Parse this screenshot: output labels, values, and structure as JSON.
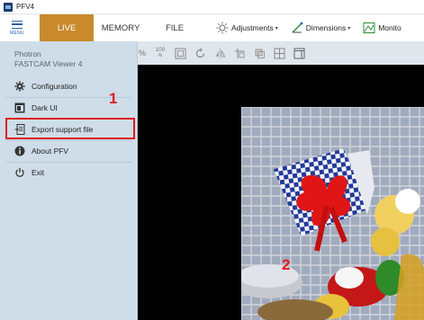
{
  "window": {
    "title": "PFV4"
  },
  "ribbon": {
    "menu_label": "MENU",
    "tabs": [
      {
        "label": "LIVE",
        "active": true
      },
      {
        "label": "MEMORY",
        "active": false
      },
      {
        "label": "FILE",
        "active": false
      }
    ],
    "groups": [
      {
        "label": "Adjustments",
        "icon": "adjustments-icon"
      },
      {
        "label": "Dimensions",
        "icon": "dimensions-icon"
      },
      {
        "label": "Monito",
        "icon": "monitor-icon"
      }
    ]
  },
  "menu": {
    "brand_line1": "Photron",
    "brand_line2": "FASTCAM Viewer 4",
    "items": [
      {
        "label": "Configuration",
        "icon": "gear-icon"
      },
      {
        "label": "Dark UI",
        "icon": "dark-ui-icon"
      },
      {
        "label": "Export support file",
        "icon": "export-file-icon"
      },
      {
        "label": "About PFV",
        "icon": "info-icon"
      },
      {
        "label": "Exit",
        "icon": "power-icon"
      }
    ]
  },
  "toolbar": {
    "percent_label": "%",
    "zoom_100_label": "100",
    "zoom_100_sub": "%"
  },
  "annotations": {
    "step1": "1",
    "step2": "2"
  },
  "colors": {
    "accent_live": "#c88a2c",
    "menu_bg": "#cfdde9",
    "highlight": "#e01a1a",
    "icon_blue": "#2a62a8"
  }
}
